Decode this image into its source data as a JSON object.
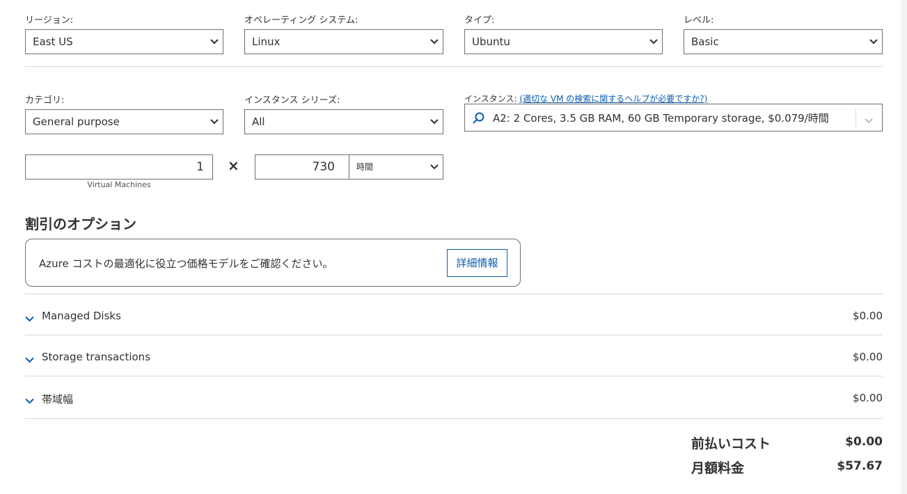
{
  "filters": {
    "region": {
      "label": "リージョン:",
      "value": "East US"
    },
    "os": {
      "label": "オペレーティング システム:",
      "value": "Linux"
    },
    "type": {
      "label": "タイプ:",
      "value": "Ubuntu"
    },
    "tier": {
      "label": "レベル:",
      "value": "Basic"
    },
    "category": {
      "label": "カテゴリ:",
      "value": "General purpose"
    },
    "series": {
      "label": "インスタンス シリーズ:",
      "value": "All"
    },
    "instance": {
      "label": "インスタンス:",
      "help_link": "(適切な VM の検索に関するヘルプが必要ですか?)",
      "value": "A2: 2 Cores, 3.5 GB RAM, 60 GB Temporary storage, $0.079/時間"
    }
  },
  "quantity": {
    "vm_count": "1",
    "vm_caption": "Virtual Machines",
    "times_symbol": "×",
    "hours": "730",
    "unit": "時間"
  },
  "discount": {
    "title": "割引のオプション",
    "message": "Azure コストの最適化に役立つ価格モデルをご確認ください。",
    "button": "詳細情報"
  },
  "accordions": [
    {
      "label": "Managed Disks",
      "price": "$0.00"
    },
    {
      "label": "Storage transactions",
      "price": "$0.00"
    },
    {
      "label": "帯域幅",
      "price": "$0.00"
    }
  ],
  "totals": {
    "upfront_label": "前払いコスト",
    "upfront_value": "$0.00",
    "monthly_label": "月額料金",
    "monthly_value": "$57.67"
  },
  "colors": {
    "accent": "#0b5cad",
    "border": "#6e6e6e",
    "divider": "#d8d8d8",
    "page_bg": "#f3f3f3"
  },
  "icons": {
    "dropdown": "chevron-down-icon",
    "search": "search-icon",
    "expand": "chevron-down-icon"
  }
}
